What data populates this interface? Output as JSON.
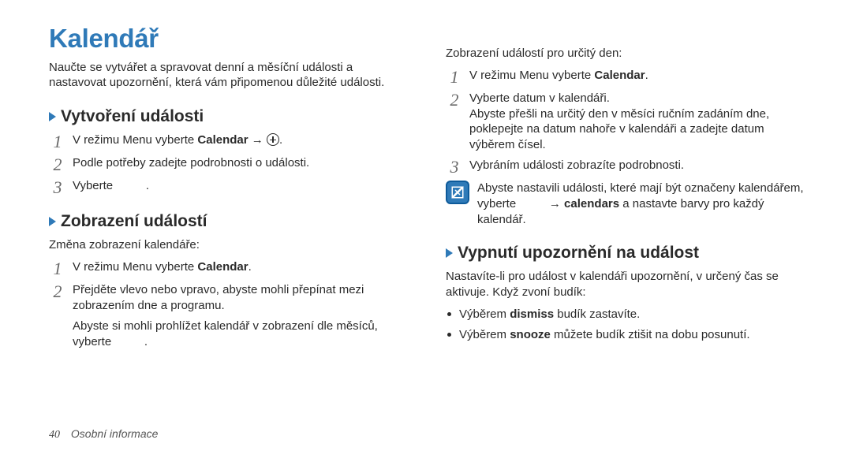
{
  "left": {
    "heading": "Kalendář",
    "intro": "Naučte se vytvářet a spravovat denní a měsíční události a nastavovat upozornění, která vám připomenou důležité události.",
    "create": {
      "title": "Vytvoření události",
      "step1_pre": "V režimu Menu vyberte ",
      "step1_bold": "Calendar",
      "step1_post": " → ",
      "step1_tail": ".",
      "step2": "Podle potřeby zadejte podrobnosti o události.",
      "step3_pre": "Vyberte",
      "step3_post": "."
    },
    "view": {
      "title": "Zobrazení událostí",
      "intro": "Změna zobrazení kalendáře:",
      "step1_pre": "V režimu Menu vyberte ",
      "step1_bold": "Calendar",
      "step1_post": ".",
      "step2": "Přejděte vlevo nebo vpravo, abyste mohli přepínat mezi zobrazením dne a programu.",
      "note_pre": "Abyste si mohli prohlížet kalendář v zobrazení dle měsíců, vyberte",
      "note_post": "."
    }
  },
  "right": {
    "intro": "Zobrazení událostí pro určitý den:",
    "step1_pre": "V režimu Menu vyberte ",
    "step1_bold": "Calendar",
    "step1_post": ".",
    "step2_a": "Vyberte datum v kalendáři.",
    "step2_b": "Abyste přešli na určitý den v měsíci ručním zadáním dne, poklepejte na datum nahoře v kalendáři a zadejte datum výběrem čísel.",
    "step3": "Vybráním události zobrazíte podrobnosti.",
    "note_a": "Abyste nastavili události, které mají být označeny kalendářem, vyberte ",
    "note_b_pre": " → ",
    "note_b_bold": "calendars",
    "note_b_post": " a nastavte barvy pro každý kalendář.",
    "alarm": {
      "title": "Vypnutí upozornění na událost",
      "intro": "Nastavíte-li pro událost v kalendáři upozornění, v určený čas se aktivuje. Když zvoní budík:",
      "b1_pre": "Výběrem ",
      "b1_bold": "dismiss",
      "b1_post": " budík zastavíte.",
      "b2_pre": "Výběrem ",
      "b2_bold": "snooze",
      "b2_post": " můžete budík ztišit na dobu posunutí."
    }
  },
  "footer": {
    "page": "40",
    "label": "Osobní informace"
  }
}
